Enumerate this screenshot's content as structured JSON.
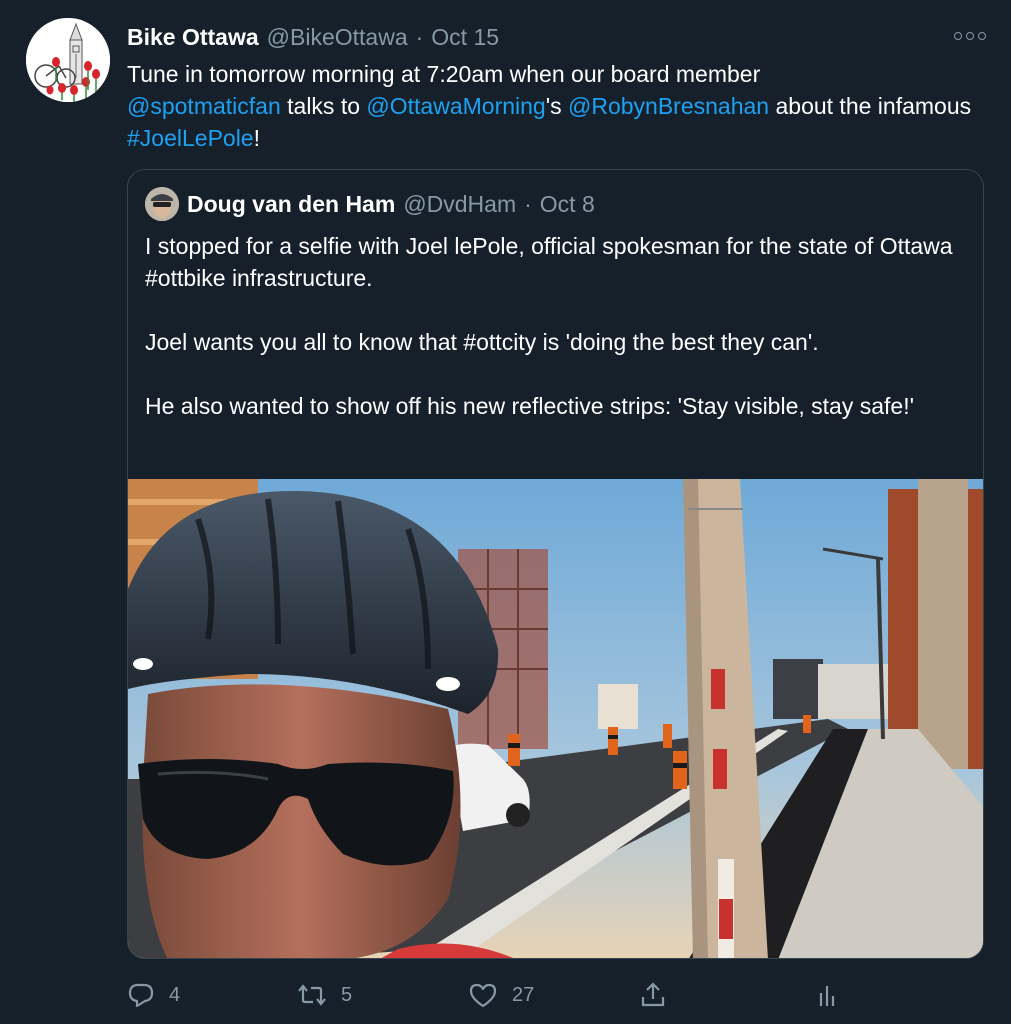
{
  "tweet": {
    "author_name": "Bike Ottawa",
    "author_handle": "@BikeOttawa",
    "separator": "·",
    "date": "Oct 15",
    "text": {
      "part1": "Tune in tomorrow morning at 7:20am when our board member",
      "mention1": "@spotmaticfan",
      "part2": " talks to ",
      "mention2": "@OttawaMorning",
      "part3": "'s ",
      "mention3": "@RobynBresnahan",
      "part4": " about the infamous ",
      "hashtag": "#JoelLePole",
      "part5": "!"
    }
  },
  "quoted": {
    "author_name": "Doug van den Ham",
    "author_handle": "@DvdHam",
    "separator": "·",
    "date": "Oct 8",
    "paragraph1": "I stopped for a selfie with Joel lePole, official spokesman for the state of Ottawa #ottbike infrastructure.",
    "paragraph2": "Joel wants you all to know that #ottcity is 'doing the best they can'.",
    "paragraph3": "He also wanted to show off his new reflective strips: 'Stay visible, stay safe!'"
  },
  "actions": {
    "reply_count": "4",
    "retweet_count": "5",
    "like_count": "27"
  },
  "icons": {
    "more": "more-icon",
    "reply": "reply-icon",
    "retweet": "retweet-icon",
    "like": "like-icon",
    "share": "share-icon",
    "analytics": "analytics-icon"
  },
  "colors": {
    "background": "#15202b",
    "link": "#1da1f2",
    "secondary_text": "#8899a6",
    "border": "#38444d"
  }
}
